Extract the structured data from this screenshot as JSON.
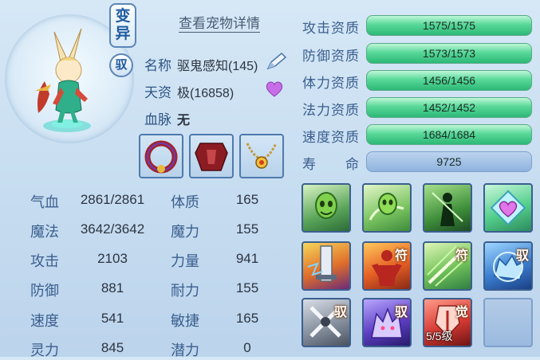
{
  "pet": {
    "tag_variant": [
      "变",
      "异"
    ],
    "tag_tamed": "驭",
    "detail_link": "查看宠物详情",
    "name_label": "名称",
    "name_value": "驱鬼感知(145)",
    "talent_label": "天资",
    "talent_value": "极(16858)",
    "bloodline_label": "血脉",
    "bloodline_value": "无"
  },
  "equipment": [
    {
      "name": "collar-red-equip"
    },
    {
      "name": "armor-red-equip"
    },
    {
      "name": "necklace-gold-equip"
    }
  ],
  "aptitudes": [
    {
      "label": "攻击资质",
      "value": "1575/1575"
    },
    {
      "label": "防御资质",
      "value": "1573/1573"
    },
    {
      "label": "体力资质",
      "value": "1456/1456"
    },
    {
      "label": "法力资质",
      "value": "1452/1452"
    },
    {
      "label": "速度资质",
      "value": "1684/1684"
    }
  ],
  "lifespan": {
    "label_a": "寿",
    "label_b": "命",
    "value": "9725"
  },
  "stats_left": [
    {
      "label": "气血",
      "value": "2861/2861"
    },
    {
      "label": "魔法",
      "value": "3642/3642"
    },
    {
      "label": "攻击",
      "value": "2103"
    },
    {
      "label": "防御",
      "value": "881"
    },
    {
      "label": "速度",
      "value": "541"
    },
    {
      "label": "灵力",
      "value": "845"
    }
  ],
  "stats_right": [
    {
      "label": "体质",
      "value": "165"
    },
    {
      "label": "魔力",
      "value": "155"
    },
    {
      "label": "力量",
      "value": "941"
    },
    {
      "label": "耐力",
      "value": "155"
    },
    {
      "label": "敏捷",
      "value": "165"
    },
    {
      "label": "潜力",
      "value": "0"
    }
  ],
  "skills": [
    {
      "icon": "green-ghost-skill-icon",
      "badge": "",
      "level": ""
    },
    {
      "icon": "green-ghost-swirl-skill-icon",
      "badge": "",
      "level": ""
    },
    {
      "icon": "green-shadow-skill-icon",
      "badge": "",
      "level": ""
    },
    {
      "icon": "heart-shield-skill-icon",
      "badge": "",
      "level": ""
    },
    {
      "icon": "sword-lightning-skill-icon",
      "badge": "",
      "level": ""
    },
    {
      "icon": "red-figure-skill-icon",
      "badge": "符",
      "level": ""
    },
    {
      "icon": "green-slash-skill-icon",
      "badge": "符",
      "level": ""
    },
    {
      "icon": "blue-wolf-skill-icon",
      "badge": "驭",
      "level": ""
    },
    {
      "icon": "crossed-swords-skill-icon",
      "badge": "驭",
      "level": ""
    },
    {
      "icon": "purple-beast-skill-icon",
      "badge": "驭",
      "level": ""
    },
    {
      "icon": "red-awaken-skill-icon",
      "badge": "觉",
      "level": "5/5级"
    },
    {
      "icon": "empty-skill-slot",
      "badge": "",
      "level": ""
    }
  ]
}
